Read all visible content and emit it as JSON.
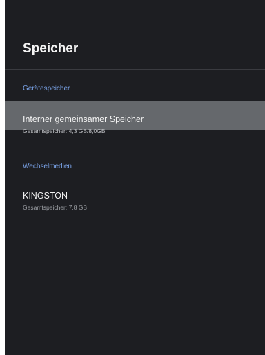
{
  "screen": {
    "title": "Speicher"
  },
  "sections": [
    {
      "header": "Gerätespeicher",
      "items": [
        {
          "label": "Interner gemeinsamer Speicher",
          "detail": "Gesamtspeicher: 4,3 GB/8,0GB",
          "focused": true
        }
      ]
    },
    {
      "header": "Wechselmedien",
      "items": [
        {
          "label": "KINGSTON",
          "detail": "Gesamtspeicher: 7,8 GB",
          "focused": false
        }
      ]
    }
  ],
  "colors": {
    "background": "#1d1e22",
    "focus_highlight": "#65686c",
    "section_header": "#7aa3e8",
    "primary_text": "#f2f2f2"
  }
}
